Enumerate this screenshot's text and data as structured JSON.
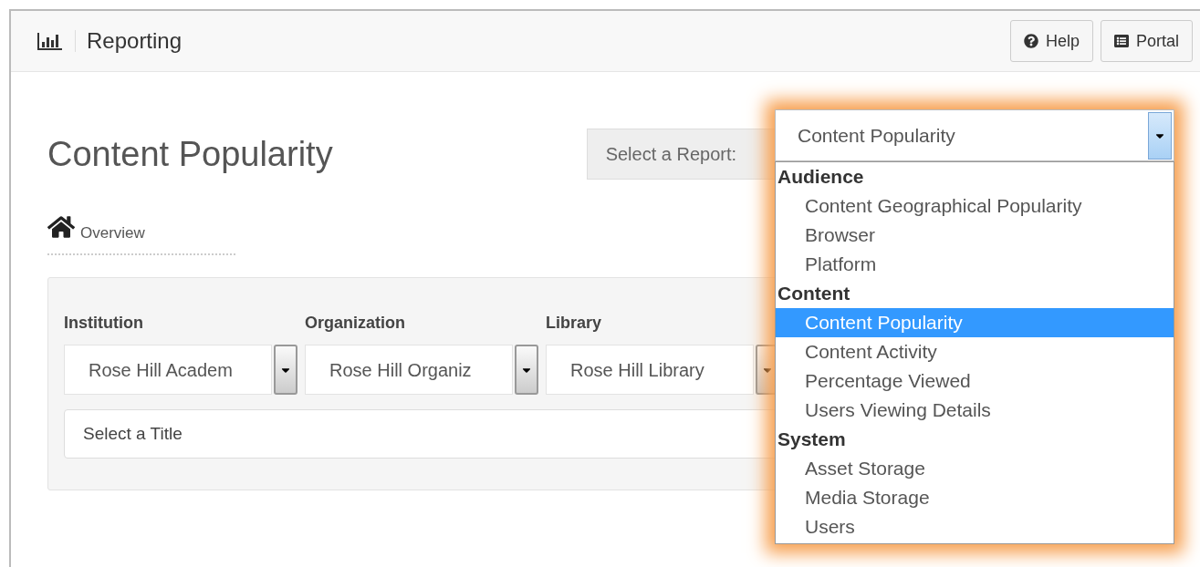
{
  "header": {
    "title": "Reporting",
    "buttons": [
      {
        "label": "Help",
        "kind": "help"
      },
      {
        "label": "Portal",
        "kind": "portal"
      }
    ]
  },
  "page_title": "Content Popularity",
  "report_select": {
    "label": "Select a Report:",
    "value": "Content Popularity",
    "expanded": true,
    "groups": [
      {
        "label": "Audience",
        "options": [
          {
            "label": "Content Geographical Popularity",
            "selected": false
          },
          {
            "label": "Browser",
            "selected": false
          },
          {
            "label": "Platform",
            "selected": false
          }
        ]
      },
      {
        "label": "Content",
        "options": [
          {
            "label": "Content Popularity",
            "selected": true
          },
          {
            "label": "Content Activity",
            "selected": false
          },
          {
            "label": "Percentage Viewed",
            "selected": false
          },
          {
            "label": "Users Viewing Details",
            "selected": false
          }
        ]
      },
      {
        "label": "System",
        "options": [
          {
            "label": "Asset Storage",
            "selected": false
          },
          {
            "label": "Media Storage",
            "selected": false
          },
          {
            "label": "Users",
            "selected": false
          }
        ]
      }
    ]
  },
  "breadcrumb": "Overview",
  "filters": [
    {
      "label": "Institution",
      "value": "Rose Hill Academ"
    },
    {
      "label": "Organization",
      "value": "Rose Hill Organiz"
    },
    {
      "label": "Library",
      "value": "Rose Hill Library"
    }
  ],
  "title_select": {
    "placeholder": "Select a Title"
  }
}
